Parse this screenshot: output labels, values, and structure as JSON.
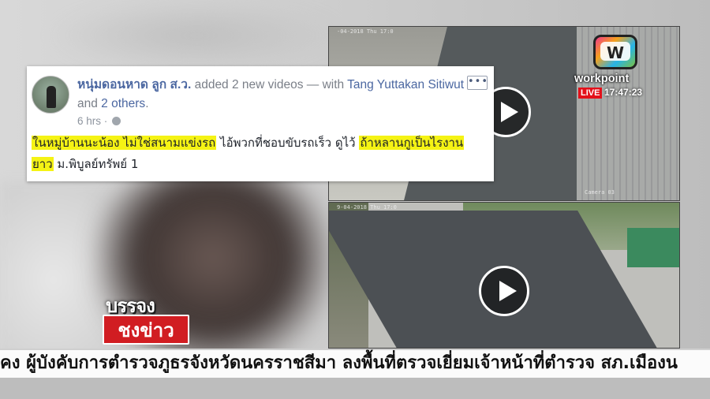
{
  "post": {
    "author": "หนุ่มดอนหาด ลูก ส.ว.",
    "action": "added 2 new videos — with ",
    "tagged": "Tang Yuttakan Sitiwut",
    "and": " and ",
    "others": "2 others",
    "period": ".",
    "time": "6 hrs",
    "more_label": "•••",
    "text_part1": "ในหมู่บ้านนะน้อง ไม่ใช่สนามแข่งรถ",
    "text_part2": " ไอ้พวกที่ชอบขับรถเร็ว ดูไว้ ",
    "text_part3": "ถ้าหลานกูเป็นไรงาน",
    "text_part4": "ยาว",
    "text_part5": " ม.พิบูลย์ทรัพย์ 1"
  },
  "videos": {
    "top_timestamp": "-04-2018 Thu 17:0",
    "top_camera": "Camera 03",
    "bottom_timestamp": "9-04-2018 Thu 17:0"
  },
  "channel": {
    "logo_letter": "W",
    "name": "workpoint",
    "live": "LIVE",
    "time": "17:47:23"
  },
  "program": {
    "line1": "บรรจง",
    "line2": "ชงข่าว"
  },
  "ticker": {
    "text": "คง  ผู้บังคับการตำรวจภูธรจังหวัดนครราชสีมา  ลงพื้นที่ตรวจเยี่ยมเจ้าหน้าที่ตำรวจ  สภ.เมืองน"
  }
}
